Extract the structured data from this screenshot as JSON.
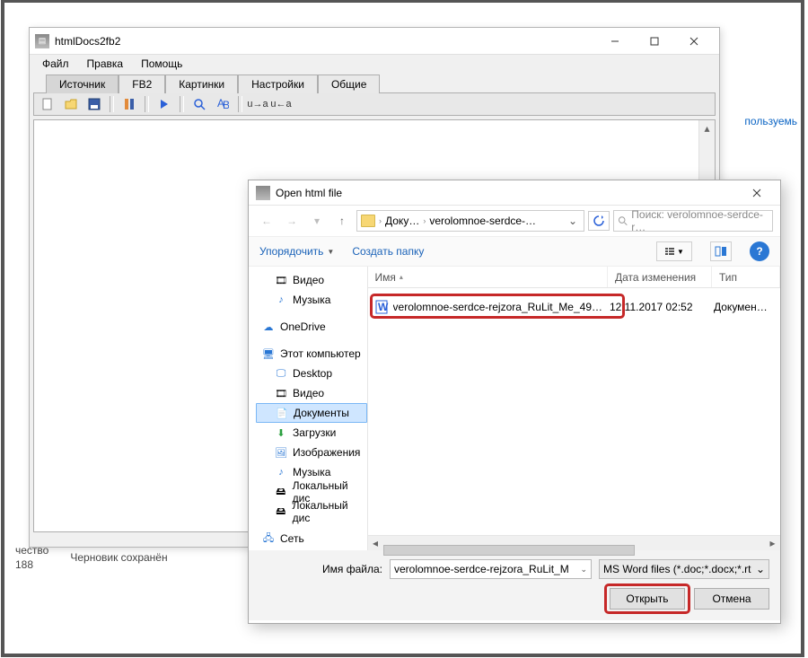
{
  "main": {
    "title": "htmlDocs2fb2",
    "menu": {
      "file": "Файл",
      "edit": "Правка",
      "help": "Помощь"
    },
    "tabs": {
      "source": "Источник",
      "fb2": "FB2",
      "pictures": "Картинки",
      "settings": "Настройки",
      "common": "Общие"
    },
    "toolbar": {
      "ua1": "u→a",
      "ua2": "u←a"
    },
    "status": {
      "quality_label": "чество",
      "quality_value": "188",
      "draft_label": "Черновик сохранён"
    },
    "right_link": "пользуемь"
  },
  "dialog": {
    "title": "Open html file",
    "breadcrumb": {
      "part1": "Доку…",
      "part2": "verolomnoe-serdce-…"
    },
    "search_placeholder": "Поиск: verolomnoe-serdce-r…",
    "organize": "Упорядочить",
    "new_folder": "Создать папку",
    "columns": {
      "name": "Имя",
      "date": "Дата изменения",
      "type": "Тип"
    },
    "tree": {
      "video": "Видео",
      "music": "Музыка",
      "onedrive": "OneDrive",
      "this_pc": "Этот компьютер",
      "desktop": "Desktop",
      "pc_video": "Видео",
      "documents": "Документы",
      "downloads": "Загрузки",
      "images": "Изображения",
      "pc_music": "Музыка",
      "localdisk1": "Локальный дис",
      "localdisk2": "Локальный дис",
      "network": "Сеть"
    },
    "file": {
      "name": "verolomnoe-serdce-rejzora_RuLit_Me_49…",
      "date": "12.11.2017 02:52",
      "type": "Документ M"
    },
    "filename_label": "Имя файла:",
    "filename_value": "verolomnoe-serdce-rejzora_RuLit_M",
    "filter": "MS Word files (*.doc;*.docx;*.rt",
    "open_btn": "Открыть",
    "cancel_btn": "Отмена"
  }
}
